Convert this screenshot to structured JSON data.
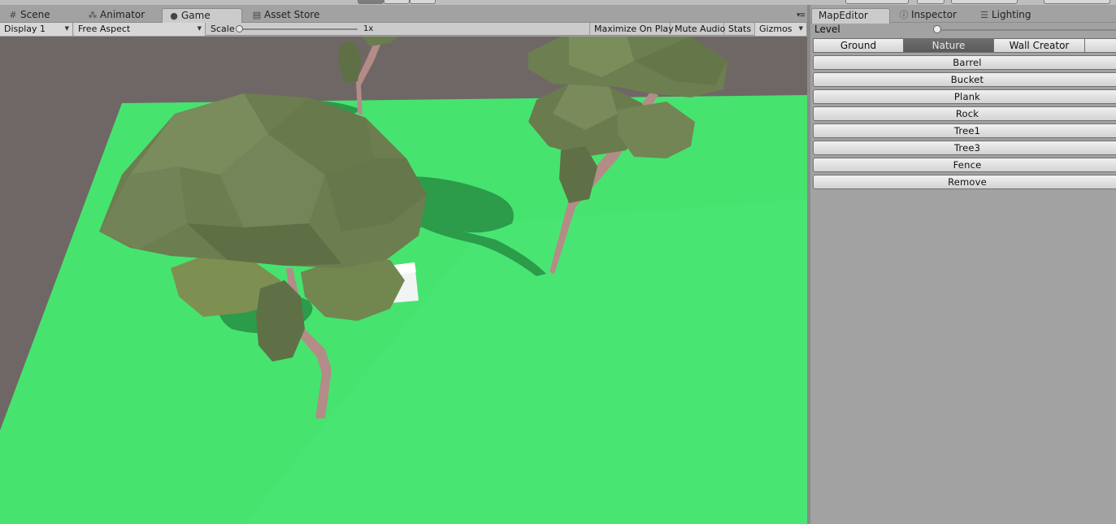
{
  "left_dock": {
    "tabs": [
      {
        "label": "Scene",
        "icon": "hash-icon",
        "active": false
      },
      {
        "label": "Animator",
        "icon": "animator-icon",
        "active": false
      },
      {
        "label": "Game",
        "icon": "game-icon",
        "active": true
      },
      {
        "label": "Asset Store",
        "icon": "store-icon",
        "active": false
      }
    ],
    "menu_glyph": "▾≡"
  },
  "game_toolbar": {
    "display": "Display 1",
    "aspect": "Free Aspect",
    "scale_label": "Scale",
    "scale_value": "1x",
    "maximize_on_play": "Maximize On Play",
    "mute_audio": "Mute Audio",
    "stats": "Stats",
    "gizmos": "Gizmos",
    "dropdown_arrow": "▼"
  },
  "right_dock": {
    "tabs": [
      {
        "label": "MapEditor",
        "icon": "",
        "active": true
      },
      {
        "label": "Inspector",
        "icon": "info-icon",
        "active": false
      },
      {
        "label": "Lighting",
        "icon": "lighting-icon",
        "active": false
      }
    ],
    "level_label": "Level",
    "level_slider_value": 0,
    "categories": [
      {
        "label": "Ground",
        "selected": false
      },
      {
        "label": "Nature",
        "selected": true
      },
      {
        "label": "Wall Creator",
        "selected": false
      }
    ],
    "items": [
      "Barrel",
      "Bucket",
      "Plank",
      "Rock",
      "Tree1",
      "Tree3",
      "Fence",
      "Remove"
    ]
  },
  "colors": {
    "grass": "#47e36f",
    "far_wall": "#6f6765",
    "foliage": "#6b7d4f",
    "trunk": "#b38c88",
    "selected_tab": "#5f5f5f"
  }
}
